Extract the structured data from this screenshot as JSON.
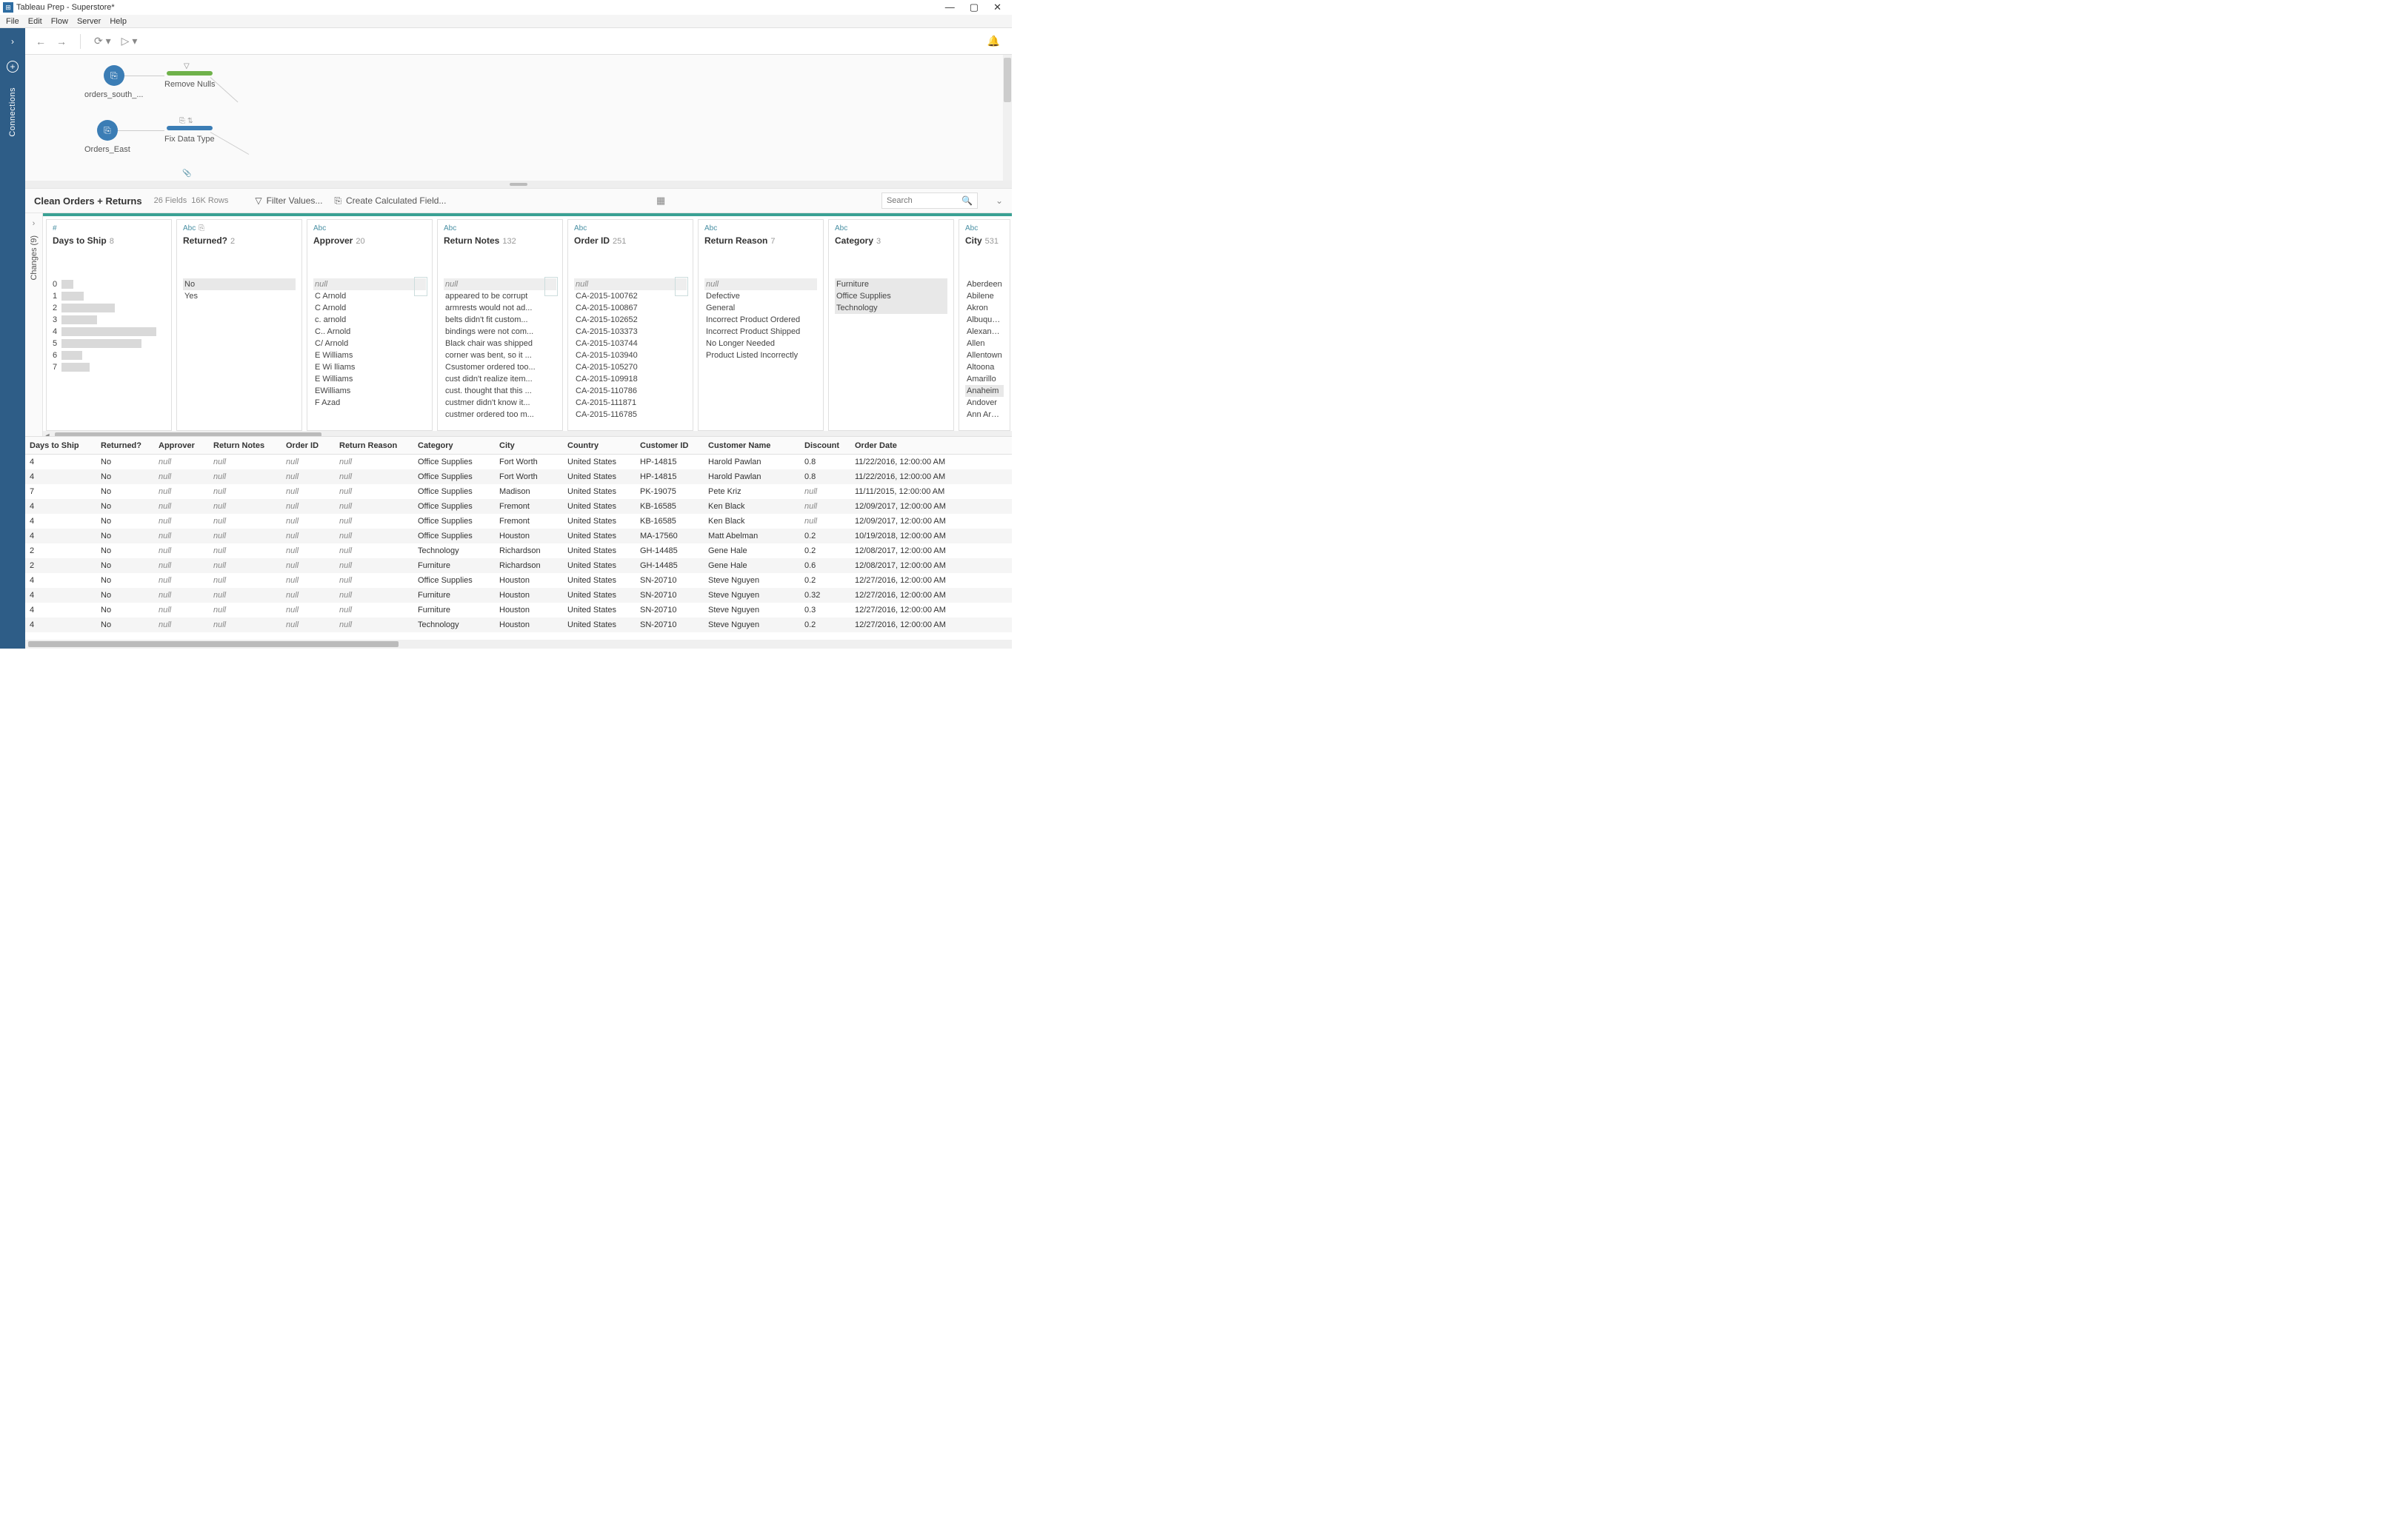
{
  "window": {
    "title": "Tableau Prep - Superstore*"
  },
  "menu": [
    "File",
    "Edit",
    "Flow",
    "Server",
    "Help"
  ],
  "sidebar": {
    "connections": "Connections"
  },
  "flow": {
    "nodes": [
      {
        "label": "orders_south_..."
      },
      {
        "label": "Remove Nulls"
      },
      {
        "label": "Orders_East"
      },
      {
        "label": "Fix Data Type"
      }
    ]
  },
  "step": {
    "name": "Clean Orders + Returns",
    "fields": "26 Fields",
    "rows": "16K Rows",
    "filter": "Filter Values...",
    "calc": "Create Calculated Field...",
    "search_ph": "Search"
  },
  "changes_label": "Changes (9)",
  "profile": [
    {
      "type": "#",
      "title": "Days to Ship",
      "count": "8",
      "bars": [
        {
          "l": "0",
          "w": 16
        },
        {
          "l": "1",
          "w": 30
        },
        {
          "l": "2",
          "w": 72
        },
        {
          "l": "3",
          "w": 48
        },
        {
          "l": "4",
          "w": 128
        },
        {
          "l": "5",
          "w": 108
        },
        {
          "l": "6",
          "w": 28
        },
        {
          "l": "7",
          "w": 38
        }
      ]
    },
    {
      "type": "Abc",
      "title": "Returned?",
      "count": "2",
      "vals": [
        {
          "t": "No",
          "c": "sel"
        },
        {
          "t": "Yes"
        }
      ],
      "extra_icon": true
    },
    {
      "type": "Abc",
      "title": "Approver",
      "count": "20",
      "hist": true,
      "vals": [
        {
          "t": "null",
          "c": "null"
        },
        {
          "t": ""
        },
        {
          "t": "C Arnold"
        },
        {
          "t": "C Arnold"
        },
        {
          "t": "c. arnold"
        },
        {
          "t": "C.. Arnold"
        },
        {
          "t": "C/ Arnold"
        },
        {
          "t": "E  Williams"
        },
        {
          "t": "E Wi lliams"
        },
        {
          "t": "E Williams"
        },
        {
          "t": "EWilliams"
        },
        {
          "t": "F Azad"
        }
      ]
    },
    {
      "type": "Abc",
      "title": "Return Notes",
      "count": "132",
      "hist": true,
      "vals": [
        {
          "t": "null",
          "c": "null"
        },
        {
          "t": "appeared to be corrupt"
        },
        {
          "t": "armrests would not ad..."
        },
        {
          "t": "belts didn't fit custom..."
        },
        {
          "t": "bindings were not com..."
        },
        {
          "t": "Black chair was shipped"
        },
        {
          "t": "corner was bent, so it ..."
        },
        {
          "t": "Csustomer ordered too..."
        },
        {
          "t": "cust didn't realize item..."
        },
        {
          "t": "cust. thought that this ..."
        },
        {
          "t": "custmer didn't know it..."
        },
        {
          "t": "custmer ordered too m..."
        }
      ]
    },
    {
      "type": "Abc",
      "title": "Order ID",
      "count": "251",
      "hist": true,
      "vals": [
        {
          "t": "null",
          "c": "null"
        },
        {
          "t": "CA-2015-100762"
        },
        {
          "t": "CA-2015-100867"
        },
        {
          "t": "CA-2015-102652"
        },
        {
          "t": "CA-2015-103373"
        },
        {
          "t": "CA-2015-103744"
        },
        {
          "t": "CA-2015-103940"
        },
        {
          "t": "CA-2015-105270"
        },
        {
          "t": "CA-2015-109918"
        },
        {
          "t": "CA-2015-110786"
        },
        {
          "t": "CA-2015-111871"
        },
        {
          "t": "CA-2015-116785"
        }
      ]
    },
    {
      "type": "Abc",
      "title": "Return Reason",
      "count": "7",
      "vals": [
        {
          "t": "null",
          "c": "null"
        },
        {
          "t": "Defective"
        },
        {
          "t": "General"
        },
        {
          "t": "Incorrect Product Ordered"
        },
        {
          "t": "Incorrect Product Shipped"
        },
        {
          "t": "No Longer Needed"
        },
        {
          "t": "Product Listed Incorrectly"
        }
      ]
    },
    {
      "type": "Abc",
      "title": "Category",
      "count": "3",
      "vals": [
        {
          "t": "Furniture",
          "c": "sel"
        },
        {
          "t": "Office Supplies",
          "c": "sel"
        },
        {
          "t": "Technology",
          "c": "sel"
        }
      ]
    },
    {
      "type": "Abc",
      "title": "City",
      "count": "531",
      "narrow": true,
      "vals": [
        {
          "t": "Aberdeen"
        },
        {
          "t": "Abilene"
        },
        {
          "t": "Akron"
        },
        {
          "t": "Albuquerqu"
        },
        {
          "t": "Alexandria"
        },
        {
          "t": "Allen"
        },
        {
          "t": "Allentown"
        },
        {
          "t": "Altoona"
        },
        {
          "t": "Amarillo"
        },
        {
          "t": "Anaheim",
          "c": "sel"
        },
        {
          "t": "Andover"
        },
        {
          "t": "Ann Arbor"
        }
      ]
    }
  ],
  "grid": {
    "cols": [
      {
        "h": "Days to Ship",
        "w": 96
      },
      {
        "h": "Returned?",
        "w": 78
      },
      {
        "h": "Approver",
        "w": 74
      },
      {
        "h": "Return Notes",
        "w": 98
      },
      {
        "h": "Order ID",
        "w": 72
      },
      {
        "h": "Return Reason",
        "w": 106
      },
      {
        "h": "Category",
        "w": 110
      },
      {
        "h": "City",
        "w": 92
      },
      {
        "h": "Country",
        "w": 98
      },
      {
        "h": "Customer ID",
        "w": 92
      },
      {
        "h": "Customer Name",
        "w": 130
      },
      {
        "h": "Discount",
        "w": 68
      },
      {
        "h": "Order Date",
        "w": 170
      }
    ],
    "rows": [
      [
        "4",
        "No",
        "null",
        "null",
        "null",
        "null",
        "Office Supplies",
        "Fort Worth",
        "United States",
        "HP-14815",
        "Harold Pawlan",
        "0.8",
        "11/22/2016, 12:00:00 AM"
      ],
      [
        "4",
        "No",
        "null",
        "null",
        "null",
        "null",
        "Office Supplies",
        "Fort Worth",
        "United States",
        "HP-14815",
        "Harold Pawlan",
        "0.8",
        "11/22/2016, 12:00:00 AM"
      ],
      [
        "7",
        "No",
        "null",
        "null",
        "null",
        "null",
        "Office Supplies",
        "Madison",
        "United States",
        "PK-19075",
        "Pete Kriz",
        "null",
        "11/11/2015, 12:00:00 AM"
      ],
      [
        "4",
        "No",
        "null",
        "null",
        "null",
        "null",
        "Office Supplies",
        "Fremont",
        "United States",
        "KB-16585",
        "Ken Black",
        "null",
        "12/09/2017, 12:00:00 AM"
      ],
      [
        "4",
        "No",
        "null",
        "null",
        "null",
        "null",
        "Office Supplies",
        "Fremont",
        "United States",
        "KB-16585",
        "Ken Black",
        "null",
        "12/09/2017, 12:00:00 AM"
      ],
      [
        "4",
        "No",
        "null",
        "null",
        "null",
        "null",
        "Office Supplies",
        "Houston",
        "United States",
        "MA-17560",
        "Matt Abelman",
        "0.2",
        "10/19/2018, 12:00:00 AM"
      ],
      [
        "2",
        "No",
        "null",
        "null",
        "null",
        "null",
        "Technology",
        "Richardson",
        "United States",
        "GH-14485",
        "Gene Hale",
        "0.2",
        "12/08/2017, 12:00:00 AM"
      ],
      [
        "2",
        "No",
        "null",
        "null",
        "null",
        "null",
        "Furniture",
        "Richardson",
        "United States",
        "GH-14485",
        "Gene Hale",
        "0.6",
        "12/08/2017, 12:00:00 AM"
      ],
      [
        "4",
        "No",
        "null",
        "null",
        "null",
        "null",
        "Office Supplies",
        "Houston",
        "United States",
        "SN-20710",
        "Steve Nguyen",
        "0.2",
        "12/27/2016, 12:00:00 AM"
      ],
      [
        "4",
        "No",
        "null",
        "null",
        "null",
        "null",
        "Furniture",
        "Houston",
        "United States",
        "SN-20710",
        "Steve Nguyen",
        "0.32",
        "12/27/2016, 12:00:00 AM"
      ],
      [
        "4",
        "No",
        "null",
        "null",
        "null",
        "null",
        "Furniture",
        "Houston",
        "United States",
        "SN-20710",
        "Steve Nguyen",
        "0.3",
        "12/27/2016, 12:00:00 AM"
      ],
      [
        "4",
        "No",
        "null",
        "null",
        "null",
        "null",
        "Technology",
        "Houston",
        "United States",
        "SN-20710",
        "Steve Nguyen",
        "0.2",
        "12/27/2016, 12:00:00 AM"
      ]
    ]
  }
}
